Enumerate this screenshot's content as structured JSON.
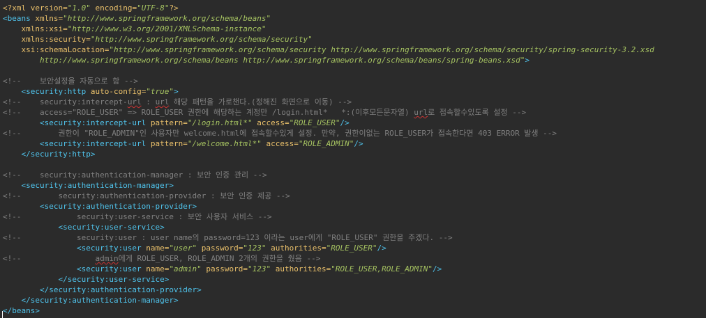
{
  "editor": {
    "background": "#2b2b2b",
    "colors": {
      "decl": "#e8bf6a",
      "tag": "#4fc1e9",
      "attr": "#e8bf6a",
      "value": "#a5c261",
      "comment": "#808080",
      "squiggle": "#cc3333"
    },
    "lines": [
      {
        "tokens": [
          {
            "t": "decl",
            "v": "<?xml version="
          },
          {
            "t": "val",
            "v": "\"1.0\""
          },
          {
            "t": "decl",
            "v": " encoding="
          },
          {
            "t": "val",
            "v": "\"UTF-8\""
          },
          {
            "t": "decl",
            "v": "?>"
          }
        ]
      },
      {
        "tokens": [
          {
            "t": "tag",
            "v": "<beans"
          },
          {
            "t": "attr",
            "v": " xmlns="
          },
          {
            "t": "val",
            "v": "\"http://www.springframework.org/schema/beans\""
          }
        ]
      },
      {
        "tokens": [
          {
            "t": "attr",
            "v": "    xmlns:xsi="
          },
          {
            "t": "val",
            "v": "\"http://www.w3.org/2001/XMLSchema-instance\""
          }
        ]
      },
      {
        "tokens": [
          {
            "t": "attr",
            "v": "    xmlns:security="
          },
          {
            "t": "val",
            "v": "\"http://www.springframework.org/schema/security\""
          }
        ]
      },
      {
        "tokens": [
          {
            "t": "attr",
            "v": "    xsi:schemaLocation="
          },
          {
            "t": "val",
            "v": "\"http://www.springframework.org/schema/security http://www.springframework.org/schema/security/spring-security-3.2.xsd"
          }
        ]
      },
      {
        "tokens": [
          {
            "t": "val",
            "v": "        http://www.springframework.org/schema/beans http://www.springframework.org/schema/beans/spring-beans.xsd\""
          },
          {
            "t": "tag",
            "v": ">"
          }
        ]
      },
      {
        "tokens": []
      },
      {
        "tokens": [
          {
            "t": "cmt",
            "v": "<!--    보안설정을 자동으로 함 -->"
          }
        ]
      },
      {
        "tokens": [
          {
            "t": "tag",
            "v": "    <security:http"
          },
          {
            "t": "attr",
            "v": " auto-config="
          },
          {
            "t": "val",
            "v": "\"true\""
          },
          {
            "t": "tag",
            "v": ">"
          }
        ]
      },
      {
        "tokens": [
          {
            "t": "cmt",
            "v": "<!--    security:intercept-"
          },
          {
            "t": "sq",
            "v": "url"
          },
          {
            "t": "cmt",
            "v": " : "
          },
          {
            "t": "sq",
            "v": "url"
          },
          {
            "t": "cmt",
            "v": " 해당 패턴을 가로챈다.(정해진 화면으로 이동) -->"
          }
        ]
      },
      {
        "tokens": [
          {
            "t": "cmt",
            "v": "<!--    access=\"ROLE_USER\" => ROLE_USER 권한에 해당하는 계정만 /login.html*   *:(이후모든문자열) "
          },
          {
            "t": "sq",
            "v": "url"
          },
          {
            "t": "cmt",
            "v": "로 접속할수있도록 설정 -->"
          }
        ]
      },
      {
        "tokens": [
          {
            "t": "tag",
            "v": "        <security:intercept-url"
          },
          {
            "t": "attr",
            "v": " pattern="
          },
          {
            "t": "val",
            "v": "\"/login.html*\""
          },
          {
            "t": "attr",
            "v": " access="
          },
          {
            "t": "val",
            "v": "\"ROLE_USER\""
          },
          {
            "t": "tag",
            "v": "/>"
          }
        ]
      },
      {
        "tokens": [
          {
            "t": "cmt",
            "v": "<!--        권한이 \"ROLE_ADMIN\"인 사용자만 welcome.html에 접속할수있게 설정. 만약, 권한이없는 ROLE_USER가 접속한다면 403 ERROR 발생 -->"
          }
        ]
      },
      {
        "tokens": [
          {
            "t": "tag",
            "v": "        <security:intercept-url"
          },
          {
            "t": "attr",
            "v": " pattern="
          },
          {
            "t": "val",
            "v": "\"/welcome.html*\""
          },
          {
            "t": "attr",
            "v": " access="
          },
          {
            "t": "val",
            "v": "\"ROLE_ADMIN\""
          },
          {
            "t": "tag",
            "v": "/>"
          }
        ]
      },
      {
        "tokens": [
          {
            "t": "tag",
            "v": "    </security:http>"
          }
        ]
      },
      {
        "tokens": []
      },
      {
        "tokens": [
          {
            "t": "cmt",
            "v": "<!--    security:authentication-manager : 보안 인증 관리 -->"
          }
        ]
      },
      {
        "tokens": [
          {
            "t": "tag",
            "v": "    <security:authentication-manager>"
          }
        ]
      },
      {
        "tokens": [
          {
            "t": "cmt",
            "v": "<!--        security:authentication-provider : 보안 인증 제공 -->"
          }
        ]
      },
      {
        "tokens": [
          {
            "t": "tag",
            "v": "        <security:authentication-provider>"
          }
        ]
      },
      {
        "tokens": [
          {
            "t": "cmt",
            "v": "<!--            security:user-service : 보안 사용자 서비스 -->"
          }
        ]
      },
      {
        "tokens": [
          {
            "t": "tag",
            "v": "            <security:user-service>"
          }
        ]
      },
      {
        "tokens": [
          {
            "t": "cmt",
            "v": "<!--            security:user : user name의 password=123 이라는 user에게 \"ROLE_USER\" 권한을 주겠다. -->"
          }
        ]
      },
      {
        "tokens": [
          {
            "t": "tag",
            "v": "                <security:user"
          },
          {
            "t": "attr",
            "v": " name="
          },
          {
            "t": "val",
            "v": "\"user\""
          },
          {
            "t": "attr",
            "v": " password="
          },
          {
            "t": "val",
            "v": "\"123\""
          },
          {
            "t": "attr",
            "v": " authorities="
          },
          {
            "t": "val",
            "v": "\"ROLE_USER\""
          },
          {
            "t": "tag",
            "v": "/>"
          }
        ]
      },
      {
        "tokens": [
          {
            "t": "cmt",
            "v": "<!--                "
          },
          {
            "t": "sq",
            "v": "admin"
          },
          {
            "t": "cmt",
            "v": "에게 ROLE_USER, ROLE_ADMIN 2개의 권한을 줬음 -->"
          }
        ]
      },
      {
        "tokens": [
          {
            "t": "tag",
            "v": "                <security:user"
          },
          {
            "t": "attr",
            "v": " name="
          },
          {
            "t": "val",
            "v": "\"admin\""
          },
          {
            "t": "attr",
            "v": " password="
          },
          {
            "t": "val",
            "v": "\"123\""
          },
          {
            "t": "attr",
            "v": " authorities="
          },
          {
            "t": "val",
            "v": "\"ROLE_USER,ROLE_ADMIN\""
          },
          {
            "t": "tag",
            "v": "/>"
          }
        ]
      },
      {
        "tokens": [
          {
            "t": "tag",
            "v": "            </security:user-service>"
          }
        ]
      },
      {
        "tokens": [
          {
            "t": "tag",
            "v": "        </security:authentication-provider>"
          }
        ]
      },
      {
        "tokens": [
          {
            "t": "tag",
            "v": "    </security:authentication-manager>"
          }
        ]
      },
      {
        "tokens": [
          {
            "t": "tag",
            "v": "</beans>"
          }
        ]
      }
    ]
  }
}
